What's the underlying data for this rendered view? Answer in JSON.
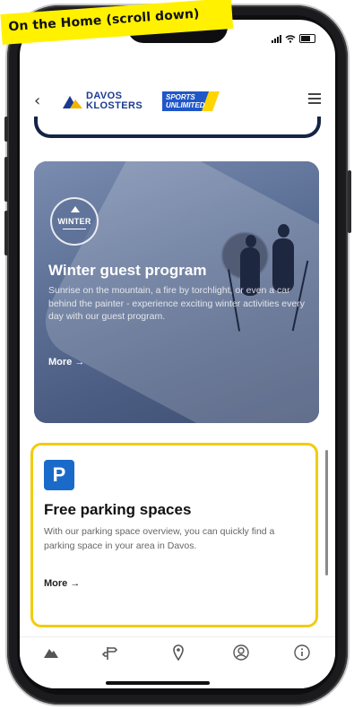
{
  "annotation": {
    "banner_text": "On the Home (scroll down)",
    "highlight_color": "#f2cc0e"
  },
  "header": {
    "back_glyph": "‹",
    "logo_line1": "DAVOS",
    "logo_line2": "KLOSTERS",
    "partner_logo_line1": "SPORTS",
    "partner_logo_line2": "UNLIMITED",
    "brand_color": "#1b3a8f"
  },
  "cards": {
    "winter": {
      "badge_text": "WINTER",
      "title": "Winter guest program",
      "description": "Sunrise on the mountain, a fire by torchlight, or even a car behind the painter - experience exciting winter activities every day with our guest program.",
      "more_label": "More →"
    },
    "parking": {
      "icon_letter": "P",
      "title": "Free parking spaces",
      "description": "With our parking space overview, you can quickly find a parking space in your area in Davos.",
      "more_label": "More →",
      "icon_color": "#1a6ac9"
    }
  },
  "bottom_nav": [
    {
      "icon": "mountain-icon"
    },
    {
      "icon": "signpost-icon"
    },
    {
      "icon": "map-pin-icon"
    },
    {
      "icon": "user-icon"
    },
    {
      "icon": "info-icon"
    }
  ]
}
